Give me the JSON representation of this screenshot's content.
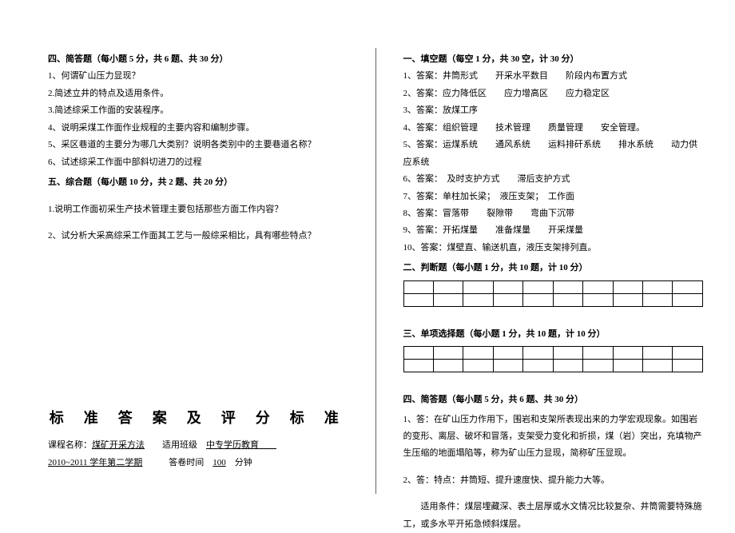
{
  "left": {
    "sec4_head": "四、简答题（每小题 5 分，共 6 题、共 30 分）",
    "q4_1": "1、何谓矿山压力显现？",
    "q4_2": "2.简述立井的特点及适用条件。",
    "q4_3": "3.简述综采工作面的安装程序。",
    "q4_4": "4、说明采煤工作面作业规程的主要内容和编制步骤。",
    "q4_5": "5、采区巷道的主要分为哪几大类别？说明各类别中的主要巷道名称？",
    "q4_6": "6、试述综采工作面中部斜切进刀的过程",
    "sec5_head": "五、综合题（每小题 10 分，共 2 题、共 20 分）",
    "q5_1": "1.说明工作面初采生产技术管理主要包括那些方面工作内容？",
    "q5_2": "2、试分析大采高综采工作面其工艺与一般综采相比，具有哪些特点？",
    "answer_title": "标 准 答 案 及 评 分 标 准",
    "meta1_a": "课程名称：",
    "meta1_b": "煤矿开采方法",
    "meta1_c": "　　适用班级　",
    "meta1_d": "中专学历教育",
    "meta2_a": "2010~2011 学年第二学期",
    "meta2_b": "　　　答卷时间　",
    "meta2_c": "100",
    "meta2_d": "　分钟"
  },
  "right": {
    "sec1_head": "一、填空题（每空 1 分，共 30 空，计 30 分）",
    "a1": "1、答案：井筒形式　　开采水平数目　　阶段内布置方式",
    "a2": "2、答案：应力降低区　　应力增高区　　应力稳定区",
    "a3": "3、答案：放煤工序",
    "a4": "4、答案：组织管理　　技术管理　　质量管理　　安全管理。",
    "a5": "5、答案：运煤系统　　通风系统　　运料排矸系统　　排水系统　　动力供应系统",
    "a6": "6、答案：　及时支护方式　　滞后支护方式",
    "a7": "7、答案：单柱加长梁；　液压支架；　工作面",
    "a8": "8、答案：冒落带　　裂隙带　　弯曲下沉带",
    "a9": "9、答案：开拓煤量　　准备煤量　　开采煤量",
    "a10": "10、答案：煤壁直、输送机直，液压支架排列直。",
    "sec2_head": "二、判断题（每小题 1 分，共 10 题，计 10 分）",
    "sec3_head": "三、单项选择题（每小题 1 分，共 10 题，计 10 分）",
    "sec4_head": "四、简答题（每小题 5 分，共 6 题、共 30 分）",
    "ans4_1": "1、答：在矿山压力作用下，围岩和支架所表现出来的力学宏观现象。如围岩的变形、离层、破坏和冒落，支架受力变化和折损，煤（岩）突出，充填物产生压缩的地面塌陷等，称为矿山压力显现，简称矿压显现。",
    "ans4_2a": "2、答：特点：井筒短、提升速度快、提升能力大等。",
    "ans4_2b": "　　适用条件：煤层埋藏深、表土层厚或水文情况比较复杂、井筒需要特殊施工，或多水平开拓急倾斜煤层。"
  }
}
